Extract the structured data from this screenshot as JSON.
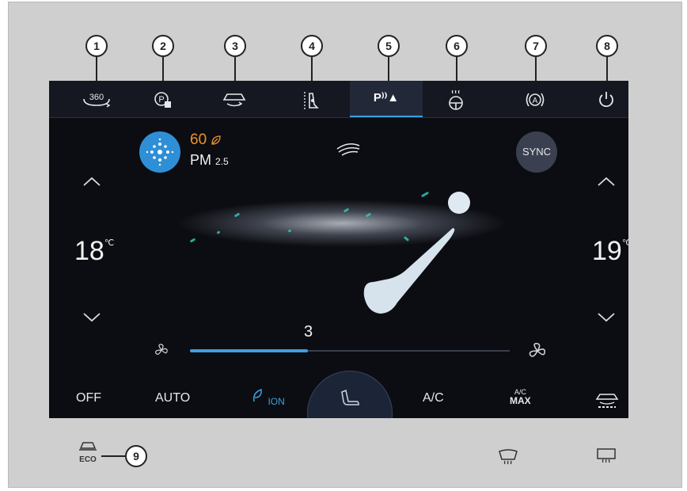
{
  "callouts": [
    "1",
    "2",
    "3",
    "4",
    "5",
    "6",
    "7",
    "8",
    "9"
  ],
  "active_tab": "P⁾⁾▲",
  "top_tabs": [
    {
      "name": "360-camera",
      "label": "360"
    },
    {
      "name": "auto-park",
      "label": ""
    },
    {
      "name": "recirculation",
      "label": ""
    },
    {
      "name": "seat-heat",
      "label": ""
    },
    {
      "name": "park-assist",
      "label": "P⁾⁾▲"
    },
    {
      "name": "steering-heat",
      "label": ""
    },
    {
      "name": "auto-hold",
      "label": ""
    },
    {
      "name": "power",
      "label": ""
    }
  ],
  "air_quality": {
    "value": "60",
    "label": "PM",
    "sub": "2.5"
  },
  "sync_label": "SYNC",
  "left_temp": {
    "value": "18",
    "unit": "℃"
  },
  "right_temp": {
    "value": "19",
    "unit": "℃"
  },
  "fan_speed": {
    "value": "3",
    "level_fraction": 0.37
  },
  "bottom_bar": {
    "off": "OFF",
    "auto": "AUTO",
    "ion": "ION",
    "ac": "A/C",
    "ac_max_top": "A/C",
    "ac_max_bottom": "MAX"
  },
  "eco_label": "ECO",
  "colors": {
    "accent": "#3d9fe0",
    "orange": "#f0922a",
    "teal": "#2fc6b8",
    "screen_bg": "#0c0d12"
  },
  "icons": [
    "360-camera-icon",
    "auto-park-icon",
    "recirculation-icon",
    "seat-heat-icon",
    "park-assist-icon",
    "steering-wheel-heat-icon",
    "auto-hold-icon",
    "power-icon",
    "purifier-icon",
    "leaf-icon",
    "airflow-icon",
    "fan-icon",
    "seat-icon",
    "ion-icon",
    "rear-defrost-icon",
    "front-defrost-icon",
    "eco-icon"
  ]
}
